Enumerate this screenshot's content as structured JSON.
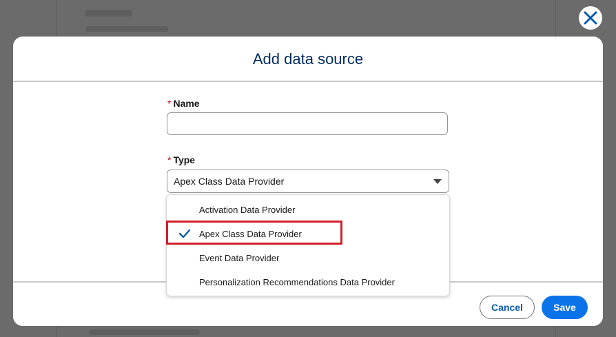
{
  "modal": {
    "title": "Add data source",
    "close_icon": "close-icon"
  },
  "form": {
    "required_marker": "*",
    "name": {
      "label": "Name",
      "value": "",
      "placeholder": ""
    },
    "type": {
      "label": "Type",
      "selected": "Apex Class Data Provider",
      "options": [
        {
          "label": "Activation Data Provider",
          "selected": false
        },
        {
          "label": "Apex Class Data Provider",
          "selected": true
        },
        {
          "label": "Event Data Provider",
          "selected": false
        },
        {
          "label": "Personalization Recommendations Data Provider",
          "selected": false
        }
      ]
    }
  },
  "footer": {
    "cancel_label": "Cancel",
    "save_label": "Save"
  },
  "colors": {
    "brand": "#0b73ea",
    "title": "#032d60",
    "required": "#ba0517",
    "highlight": "#d0202a"
  }
}
